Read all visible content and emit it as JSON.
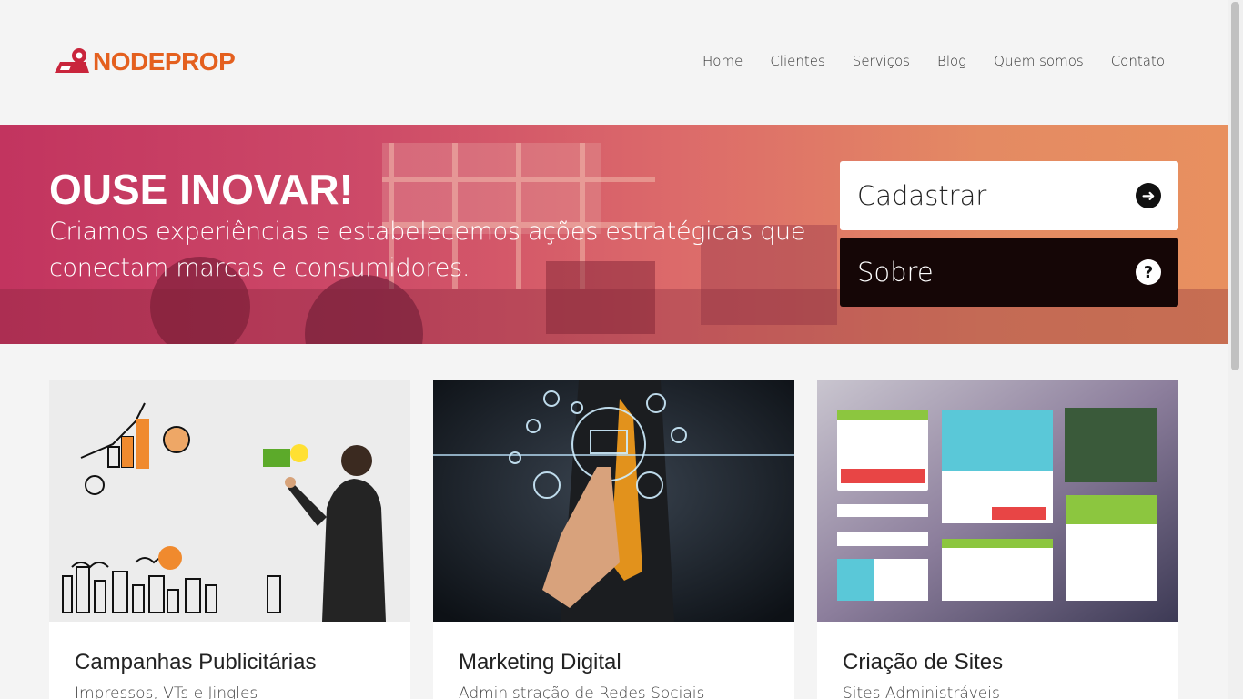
{
  "brand": {
    "name": "NODEPROP",
    "color": "#e4601f"
  },
  "nav": [
    "Home",
    "Clientes",
    "Serviços",
    "Blog",
    "Quem somos",
    "Contato"
  ],
  "hero": {
    "title": "OUSE INOVAR!",
    "subtitle": "Criamos experiências e estabelecemos ações estratégicas que conectam marcas e consumidores.",
    "cta_primary": {
      "label": "Cadastrar",
      "icon": "arrow-right-circle-icon"
    },
    "cta_secondary": {
      "label": "Sobre",
      "icon": "question-circle-icon"
    }
  },
  "cards": [
    {
      "title": "Campanhas Publicitárias",
      "subtitle": "Impressos, VTs e Jingles"
    },
    {
      "title": "Marketing Digital",
      "subtitle": "Administração de Redes Sociais"
    },
    {
      "title": "Criação de Sites",
      "subtitle": "Sites Administráveis"
    }
  ]
}
